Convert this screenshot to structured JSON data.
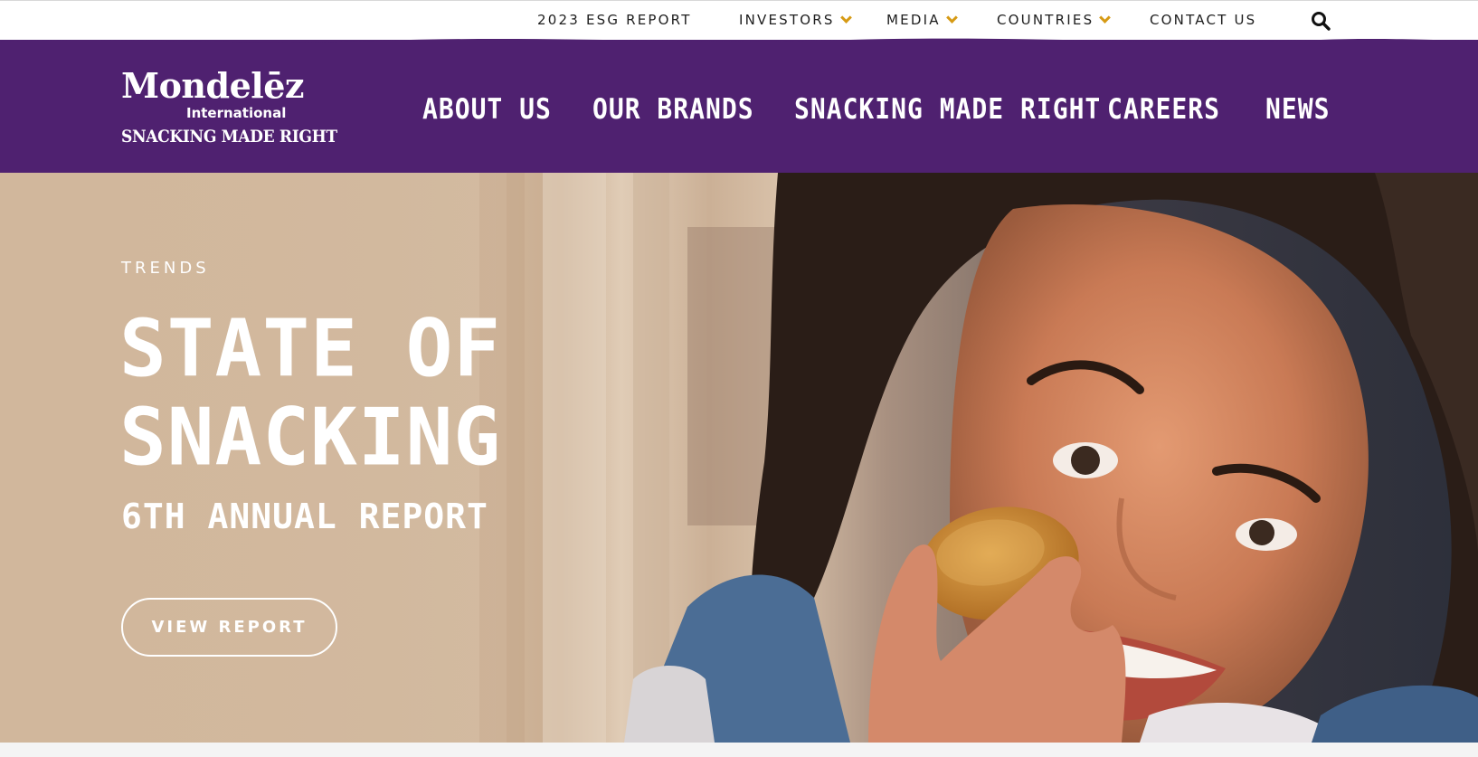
{
  "utility_nav": {
    "esg_report": "2023 ESG REPORT",
    "investors": "INVESTORS",
    "media": "MEDIA",
    "countries": "COUNTRIES",
    "contact": "CONTACT US"
  },
  "brand": {
    "name": "Mondelēz",
    "sub": "International",
    "tagline": "SNACKING MADE RIGHT"
  },
  "main_nav": {
    "about": "ABOUT US",
    "brands": "OUR BRANDS",
    "snacking": "SNACKING MADE RIGHT",
    "careers": "CAREERS",
    "news": "NEWS"
  },
  "hero": {
    "kicker": "TRENDS",
    "headline": "STATE OF\nSNACKING",
    "subhead": "6TH ANNUAL REPORT",
    "cta": "VIEW REPORT"
  },
  "colors": {
    "brand_purple": "#4f2170",
    "accent_gold": "#d69a14",
    "hero_beige": "#d1b79c"
  }
}
